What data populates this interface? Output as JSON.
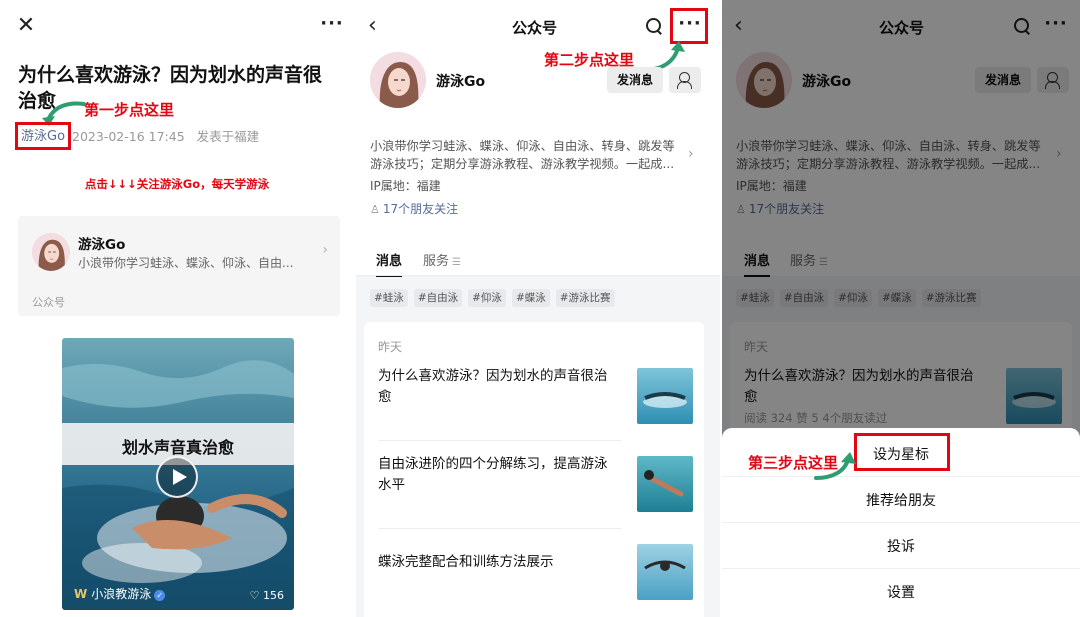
{
  "panel1": {
    "article_title": "为什么喜欢游泳？因为划水的声音很治愈",
    "author": "游泳Go",
    "date": "2023-02-16 17:45",
    "published_in": "发表于福建",
    "step1_annotation": "第一步点这里",
    "follow_prompt": "点击↓↓↓关注游泳Go，每天学游泳",
    "card": {
      "name": "游泳Go",
      "desc": "小浪带你学习蛙泳、蝶泳、仰泳、自由...",
      "type": "公众号"
    },
    "video": {
      "title": "划水声音真治愈",
      "author": "小浪教游泳",
      "likes": "156"
    }
  },
  "panel2": {
    "nav_title": "公众号",
    "step2_annotation": "第二步点这里",
    "profile": {
      "name": "游泳Go",
      "message_button": "发消息",
      "bio": "小浪带你学习蛙泳、蝶泳、仰泳、自由泳、转身、跳发等游泳技巧；定期分享游泳教程、游泳教学视频。一起成...",
      "ip": "IP属地：福建",
      "friends": "17个朋友关注"
    },
    "tabs": [
      "消息",
      "服务"
    ],
    "tags": [
      "#蛙泳",
      "#自由泳",
      "#仰泳",
      "#蝶泳",
      "#游泳比赛"
    ],
    "feed": {
      "date": "昨天",
      "articles": [
        {
          "title": "为什么喜欢游泳？因为划水的声音很治愈"
        },
        {
          "title": "自由泳进阶的四个分解练习，提高游泳水平"
        },
        {
          "title": "蝶泳完整配合和训练方法展示"
        }
      ]
    }
  },
  "panel3": {
    "nav_title": "公众号",
    "profile": {
      "name": "游泳Go",
      "message_button": "发消息",
      "bio": "小浪带你学习蛙泳、蝶泳、仰泳、自由泳、转身、跳发等游泳技巧；定期分享游泳教程、游泳教学视频。一起成...",
      "ip": "IP属地：福建",
      "friends": "17个朋友关注"
    },
    "tabs": [
      "消息",
      "服务"
    ],
    "tags": [
      "#蛙泳",
      "#自由泳",
      "#仰泳",
      "#蝶泳",
      "#游泳比赛"
    ],
    "feed": {
      "date": "昨天",
      "article_title": "为什么喜欢游泳？因为划水的声音很治愈",
      "article_meta": "阅读 324  赞 5  4个朋友读过"
    },
    "step3_annotation": "第三步点这里",
    "sheet": {
      "star": "设为星标",
      "recommend": "推荐给朋友",
      "report": "投诉",
      "settings": "设置"
    }
  },
  "colors": {
    "annotation_red": "#e30613",
    "link_blue": "#576b95",
    "arrow_teal": "#2e9e72"
  }
}
